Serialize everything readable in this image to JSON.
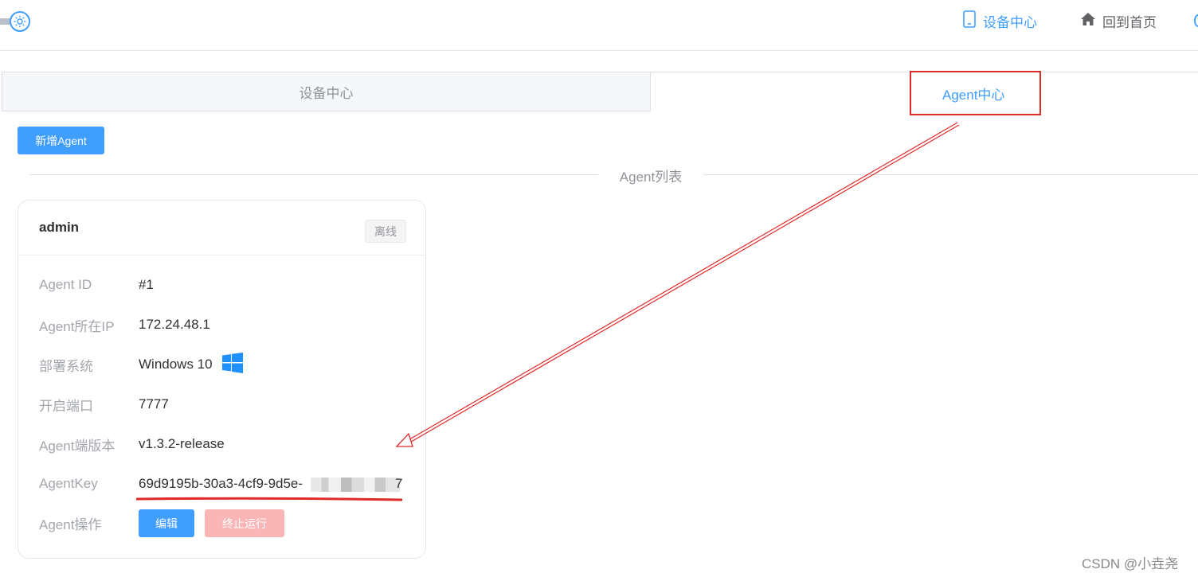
{
  "header": {
    "nav": [
      {
        "label": "设备中心",
        "icon": "tablet-icon",
        "active": true
      },
      {
        "label": "回到首页",
        "icon": "home-icon",
        "active": false
      }
    ]
  },
  "tabs": [
    {
      "label": "设备中心",
      "active": false
    },
    {
      "label": "Agent中心",
      "active": true
    }
  ],
  "toolbar": {
    "add_label": "新增Agent"
  },
  "divider": {
    "label": "Agent列表"
  },
  "card": {
    "title": "admin",
    "status": "离线",
    "rows": [
      {
        "label": "Agent ID",
        "value": "#1"
      },
      {
        "label": "Agent所在IP",
        "value": "172.24.48.1"
      },
      {
        "label": "部署系统",
        "value": "Windows 10",
        "icon": "windows-icon"
      },
      {
        "label": "开启端口",
        "value": "7777"
      },
      {
        "label": "Agent端版本",
        "value": "v1.3.2-release"
      },
      {
        "label": "AgentKey",
        "value": "69d9195b-30a3-4cf9-9d5e-",
        "suffix": "7"
      },
      {
        "label": "Agent操作"
      }
    ],
    "actions": {
      "edit_label": "编辑",
      "stop_label": "终止运行"
    }
  },
  "annotation": {
    "highlight_color": "#e02a2a",
    "arrow_color": "#e02a2a"
  },
  "colors": {
    "primary": "#409eff",
    "danger_disabled": "#fab6b6"
  },
  "watermark": "CSDN @小垚尧"
}
